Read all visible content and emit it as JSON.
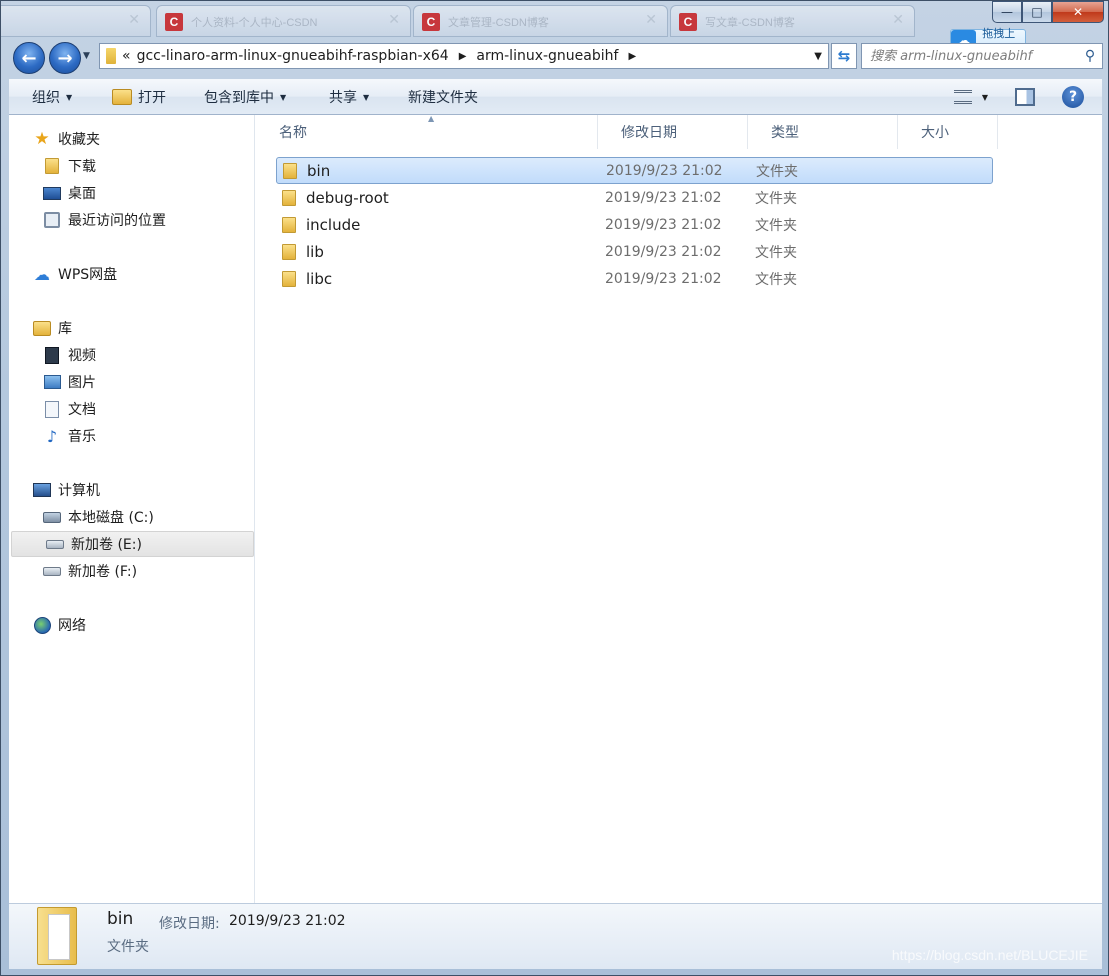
{
  "background_tabs": [
    {
      "label": "个人资料-个人中心-CSDN"
    },
    {
      "label": "文章管理-CSDN博客"
    },
    {
      "label": "写文章-CSDN博客"
    }
  ],
  "window_buttons": {
    "minimize": "—",
    "maximize": "□",
    "close": "✕"
  },
  "cloud_tip": {
    "label": "拖拽上传"
  },
  "address_bar": {
    "prefix": "«",
    "crumbs": [
      "gcc-linaro-arm-linux-gnueabihf-raspbian-x64",
      "arm-linux-gnueabihf"
    ]
  },
  "search": {
    "placeholder": "搜索 arm-linux-gnueabihf"
  },
  "toolbar": {
    "organize": "组织",
    "open": "打开",
    "include_in_library": "包含到库中",
    "share": "共享",
    "new_folder": "新建文件夹"
  },
  "nav_pane": {
    "favorites": {
      "label": "收藏夹",
      "items": [
        "下载",
        "桌面",
        "最近访问的位置"
      ]
    },
    "wps": {
      "label": "WPS网盘"
    },
    "libraries": {
      "label": "库",
      "items": [
        "视频",
        "图片",
        "文档",
        "音乐"
      ]
    },
    "computer": {
      "label": "计算机",
      "items": [
        "本地磁盘 (C:)",
        "新加卷 (E:)",
        "新加卷 (F:)"
      ]
    },
    "network": {
      "label": "网络"
    }
  },
  "columns": {
    "name": "名称",
    "modified": "修改日期",
    "type": "类型",
    "size": "大小"
  },
  "files": [
    {
      "name": "bin",
      "modified": "2019/9/23 21:02",
      "type": "文件夹"
    },
    {
      "name": "debug-root",
      "modified": "2019/9/23 21:02",
      "type": "文件夹"
    },
    {
      "name": "include",
      "modified": "2019/9/23 21:02",
      "type": "文件夹"
    },
    {
      "name": "lib",
      "modified": "2019/9/23 21:02",
      "type": "文件夹"
    },
    {
      "name": "libc",
      "modified": "2019/9/23 21:02",
      "type": "文件夹"
    }
  ],
  "details": {
    "name": "bin",
    "modified_label": "修改日期:",
    "modified_value": "2019/9/23 21:02",
    "type": "文件夹"
  },
  "watermark": "https://blog.csdn.net/BLUCEJIE"
}
